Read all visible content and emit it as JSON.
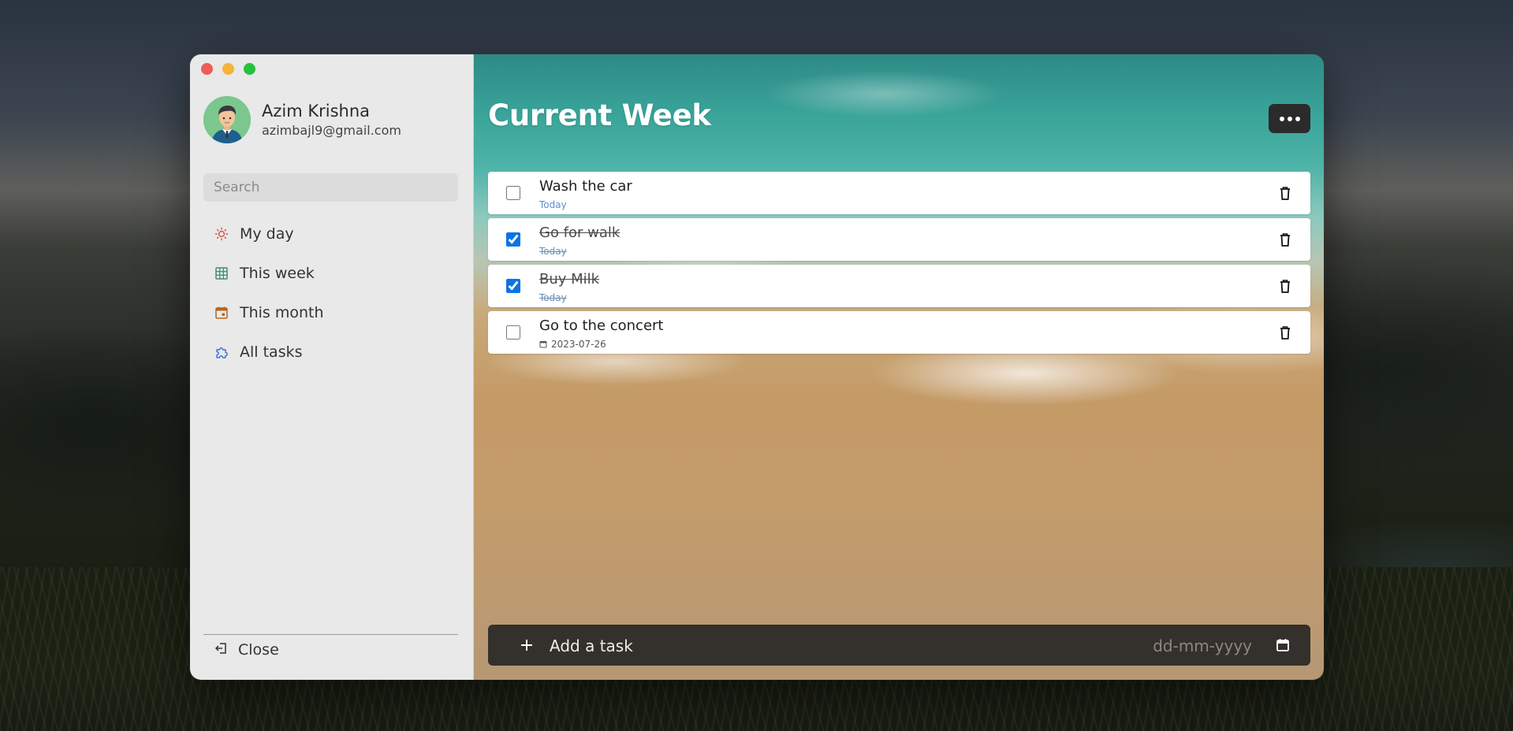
{
  "window": {
    "controls": [
      "close",
      "minimize",
      "maximize"
    ]
  },
  "profile": {
    "name": "Azim Krishna",
    "email": "azimbajl9@gmail.com"
  },
  "search": {
    "placeholder": "Search"
  },
  "nav": {
    "items": [
      {
        "label": "My day",
        "icon": "sun-icon",
        "color": "#d9534f"
      },
      {
        "label": "This week",
        "icon": "grid-icon",
        "color": "#3a8f6a"
      },
      {
        "label": "This month",
        "icon": "calendar-icon",
        "color": "#b5651d"
      },
      {
        "label": "All tasks",
        "icon": "puzzle-icon",
        "color": "#3a6fd8"
      }
    ]
  },
  "footer": {
    "close_label": "Close"
  },
  "main": {
    "title": "Current Week",
    "tasks": [
      {
        "title": "Wash the car",
        "meta": "Today",
        "done": false
      },
      {
        "title": "Go for walk",
        "meta": "Today",
        "done": true
      },
      {
        "title": "Buy Milk",
        "meta": "Today",
        "done": true
      },
      {
        "title": "Go to the concert",
        "meta": "2023-07-26",
        "done": false
      }
    ],
    "add_task": {
      "placeholder": "Add a task",
      "date_placeholder": "dd-mm-yyyy"
    }
  },
  "colors": {
    "accent": "#0a74e6",
    "add_bar": "#34302c",
    "sidebar": "#e8e9e8"
  }
}
